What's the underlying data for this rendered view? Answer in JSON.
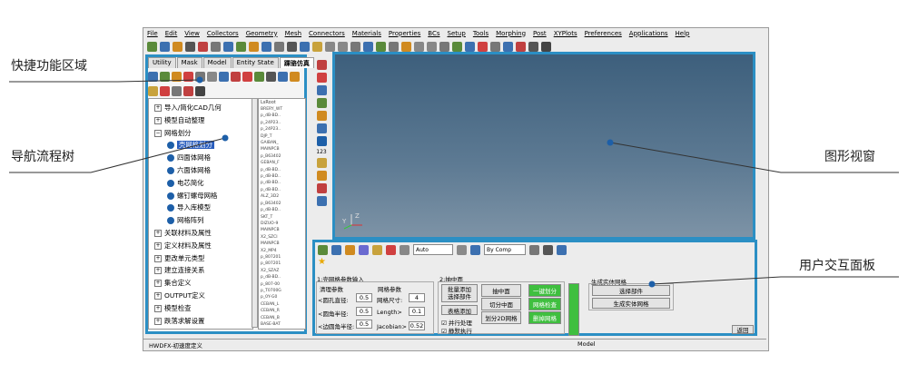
{
  "menu": [
    "File",
    "Edit",
    "View",
    "Collectors",
    "Geometry",
    "Mesh",
    "Connectors",
    "Materials",
    "Properties",
    "BCs",
    "Setup",
    "Tools",
    "Morphing",
    "Post",
    "XYPlots",
    "Preferences",
    "Applications",
    "Help"
  ],
  "tabs": [
    "Utility",
    "Mask",
    "Model",
    "Entity State",
    "踝骆仿真"
  ],
  "tree": {
    "items": [
      {
        "label": "导入/简化CAD几何",
        "type": "plus"
      },
      {
        "label": "模型自动整理",
        "type": "plus"
      },
      {
        "label": "网格划分",
        "type": "minus"
      },
      {
        "label": "壳网格划分",
        "type": "dot",
        "selected": true
      },
      {
        "label": "四面体网格",
        "type": "dot"
      },
      {
        "label": "六面体网格",
        "type": "dot"
      },
      {
        "label": "电芯简化",
        "type": "dot"
      },
      {
        "label": "螺钉螺母网格",
        "type": "dot"
      },
      {
        "label": "导入库模型",
        "type": "dot"
      },
      {
        "label": "网格阵列",
        "type": "dot"
      },
      {
        "label": "关联材料及属性",
        "type": "plus"
      },
      {
        "label": "定义材料及属性",
        "type": "plus"
      },
      {
        "label": "更改单元类型",
        "type": "plus"
      },
      {
        "label": "建立连接关系",
        "type": "plus"
      },
      {
        "label": "集合定义",
        "type": "plus"
      },
      {
        "label": "OUTPUT定义",
        "type": "plus"
      },
      {
        "label": "模型检查",
        "type": "plus"
      },
      {
        "label": "跌落求解设置",
        "type": "plus"
      }
    ]
  },
  "model_header": "LsRoot",
  "model_items": [
    "BRERY_WT",
    "p_dB-BD..",
    "p_24P23..",
    "p_24P23..",
    "DJP_T",
    "GAIBAN_",
    "MAINPCB",
    "p_B63402",
    "GEBAN_F",
    "p_dB-BD..",
    "p_dB-BD..",
    "p_dB-BD..",
    "p_dB-BD..",
    "ALZ_3D2",
    "p_B63402",
    "p_dB-BD..",
    "SKT_T",
    "DIZUO-9",
    "MAINPCB",
    "X2_SZCI",
    "MAINPCB",
    "X2_MP4",
    "p_807201",
    "p_807201",
    "X2_SZAZ",
    "p_dB-BD..",
    "p_807-00",
    "p_T0700G",
    "p_0Y-G0",
    "CEBAN_L",
    "CEBAN_R",
    "CEBAN_B",
    "BASE-BAT"
  ],
  "view_number": "123",
  "axis_y": "Y",
  "axis_z": "Z",
  "panel": {
    "toolbar_auto": "Auto",
    "toolbar_bycomp": "By Comp",
    "section1": "1:壳网格参数输入",
    "clear_params": "清理参数",
    "mesh_params": "网格参数",
    "hole_dia_label": "<圆孔直径:",
    "hole_dia_value": "0.5",
    "corner_r_label": "<圆角半径:",
    "corner_r_value": "0.5",
    "edge_r_label": "<边圆角半径:",
    "edge_r_value": "0.5",
    "mesh_size_label": "网格尺寸:",
    "mesh_size_value": "4",
    "length_label": "Length>",
    "length_value": "0.1",
    "jacobian_label": "Jacobian>",
    "jacobian_value": "0.52",
    "section2": "2:抽中面",
    "batch_add": "批量添加",
    "select_parts": "选择部件",
    "table_add": "表格添加",
    "extract_mid": "抽中面",
    "cut_mid": "切分中面",
    "mesh_2d": "划分2D网格",
    "parallel": "并行处理",
    "silent": "静默执行",
    "one_key": "一键划分",
    "mesh_check": "网格检查",
    "del_mesh": "删掉网格",
    "section3": "生成实体网格",
    "select_part": "选择部件",
    "gen_solid": "生成实体网格",
    "back": "返回"
  },
  "status": {
    "left": "HWDFX-初速度定义",
    "model": "Model"
  },
  "callouts": {
    "quick": "快捷功能区域",
    "tree": "导航流程树",
    "view": "图形视窗",
    "panel": "用户交互面板"
  },
  "colors": {
    "accent": "#2b8fc4",
    "viewport_top": "#3d5f7c",
    "viewport_bottom": "#7d93a6",
    "green_button": "#3fbf3f",
    "selection": "#2a5ebd"
  }
}
